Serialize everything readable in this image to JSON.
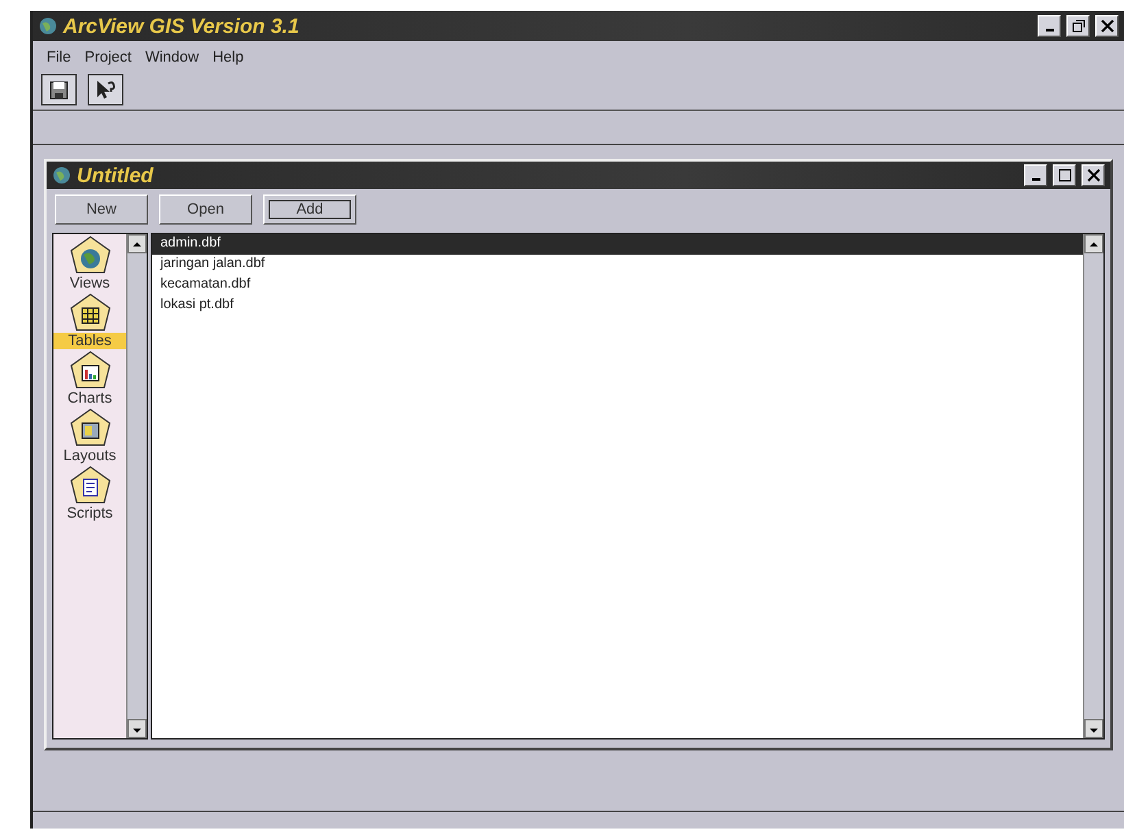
{
  "window": {
    "title": "ArcView GIS Version 3.1"
  },
  "menu": [
    "File",
    "Project",
    "Window",
    "Help"
  ],
  "toolbar": [
    {
      "kind": "save"
    },
    {
      "kind": "help"
    }
  ],
  "project_window": {
    "title": "Untitled",
    "buttons": [
      {
        "label": "New",
        "focused": false
      },
      {
        "label": "Open",
        "focused": false
      },
      {
        "label": "Add",
        "focused": true
      }
    ],
    "doc_types": [
      {
        "label": "Views",
        "kind": "views",
        "selected": false
      },
      {
        "label": "Tables",
        "kind": "tables",
        "selected": true
      },
      {
        "label": "Charts",
        "kind": "charts",
        "selected": false
      },
      {
        "label": "Layouts",
        "kind": "layouts",
        "selected": false
      },
      {
        "label": "Scripts",
        "kind": "scripts",
        "selected": false
      }
    ],
    "documents": [
      {
        "name": "admin.dbf",
        "selected": true
      },
      {
        "name": "jaringan jalan.dbf",
        "selected": false
      },
      {
        "name": "kecamatan.dbf",
        "selected": false
      },
      {
        "name": "lokasi pt.dbf",
        "selected": false
      }
    ]
  }
}
